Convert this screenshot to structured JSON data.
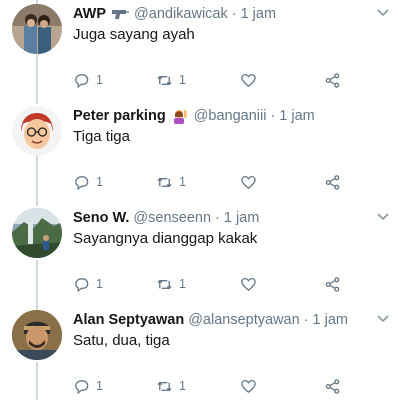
{
  "tweets": [
    {
      "name": "AWP",
      "emoji_icon": "pistol-emoji-icon",
      "handle": "@andikawicak",
      "separator": "·",
      "time": "1 jam",
      "text": "Juga sayang ayah",
      "reply_count": "1",
      "retweet_count": "1"
    },
    {
      "name": "Peter parking",
      "emoji_icon": "woman-raising-hand-emoji-icon",
      "handle": "@banganiii",
      "separator": "·",
      "time": "1 jam",
      "text": "Tiga tiga",
      "reply_count": "1",
      "retweet_count": "1"
    },
    {
      "name": "Seno W.",
      "handle": "@senseenn",
      "separator": "·",
      "time": "1 jam",
      "text": "Sayangnya dianggap kakak",
      "reply_count": "1",
      "retweet_count": "1"
    },
    {
      "name": "Alan Septyawan",
      "handle": "@alanseptyawan",
      "separator": "·",
      "time": "1 jam",
      "text": "Satu, dua, tiga",
      "reply_count": "1",
      "retweet_count": "1"
    }
  ],
  "colors": {
    "text": "#14171a",
    "secondary": "#657786",
    "thread_line": "#cfd9de"
  }
}
